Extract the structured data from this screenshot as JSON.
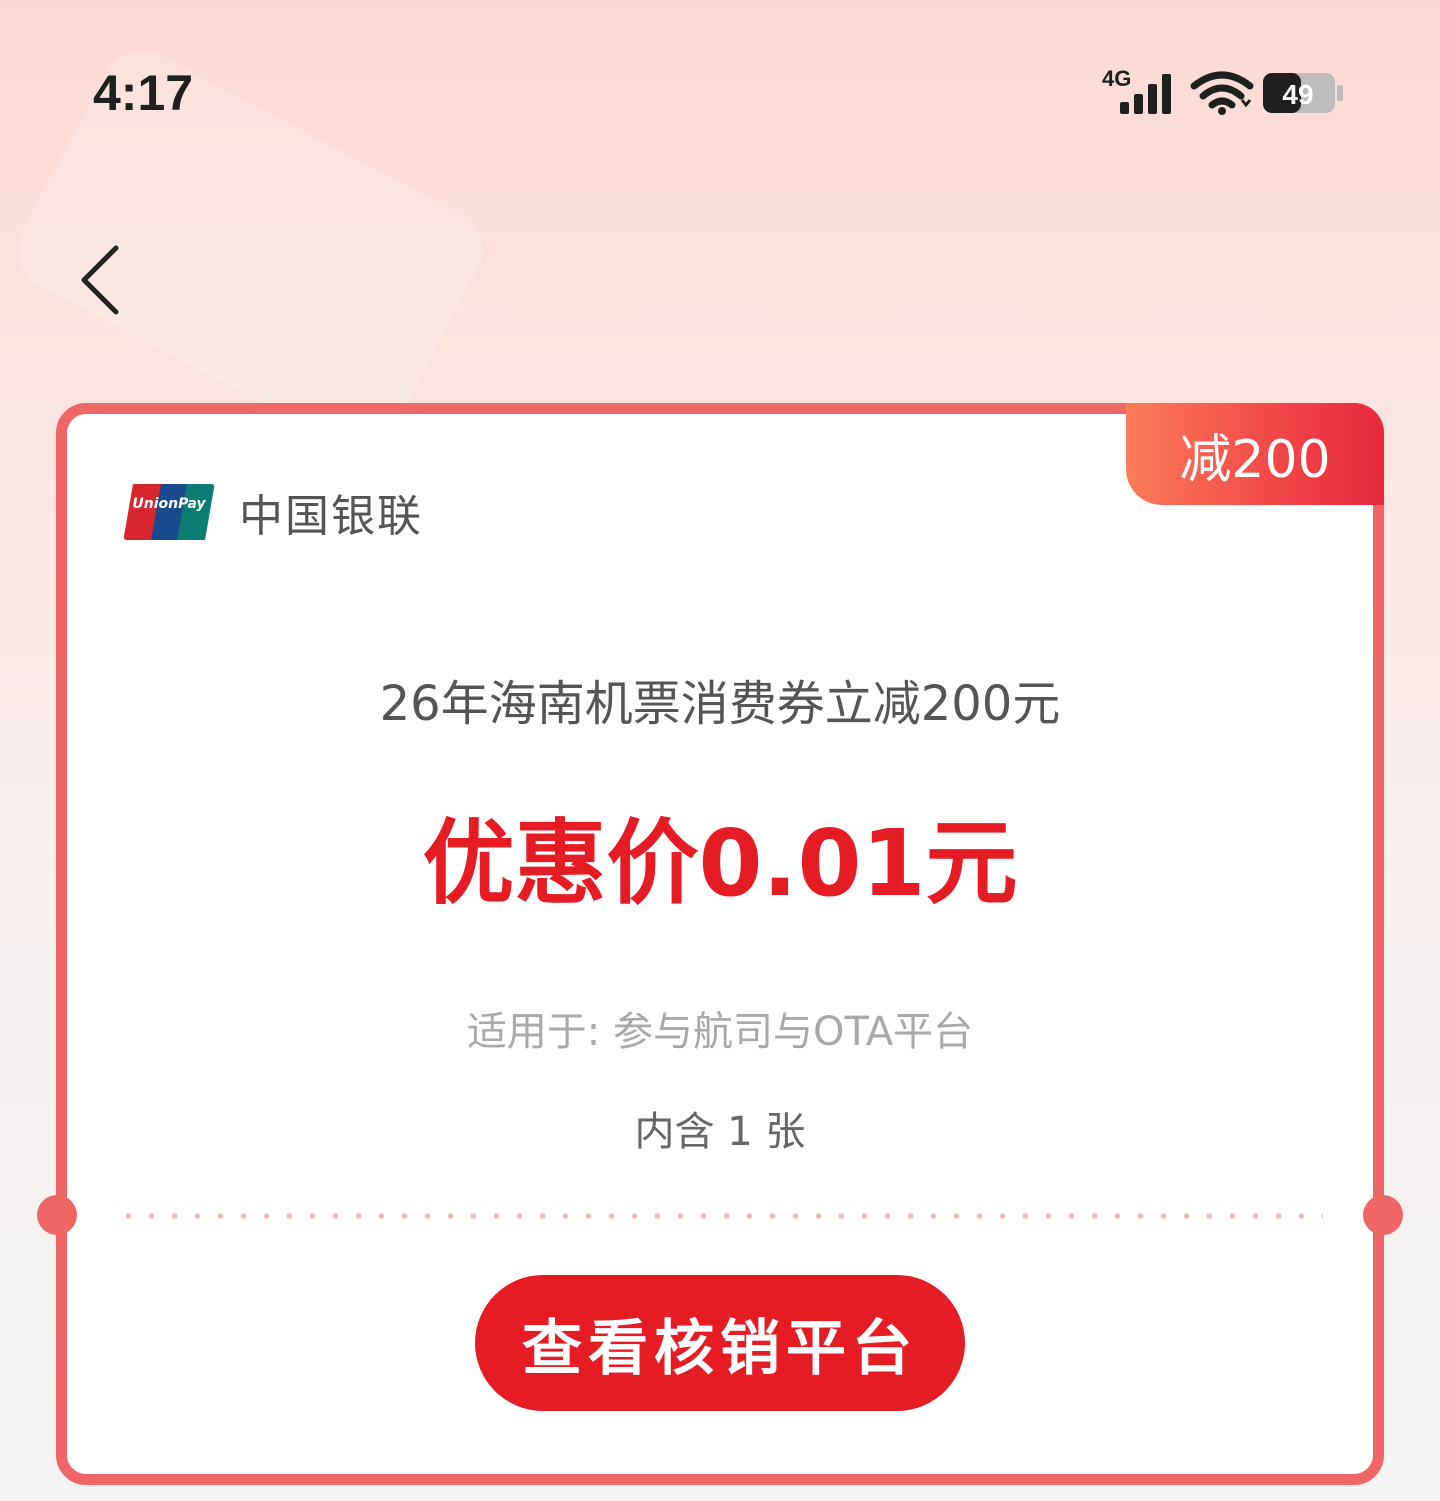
{
  "status_bar": {
    "time": "4:17",
    "network": "4G",
    "battery": "49"
  },
  "coupon": {
    "badge": "减200",
    "brand_name": "中国银联",
    "title": "26年海南机票消费券立减200元",
    "price": "优惠价0.01元",
    "scope": "适用于: 参与航司与OTA平台",
    "count": "内含 1 张",
    "button_label": "查看核销平台"
  },
  "colors": {
    "accent": "#e51c23",
    "border": "#f06565"
  }
}
